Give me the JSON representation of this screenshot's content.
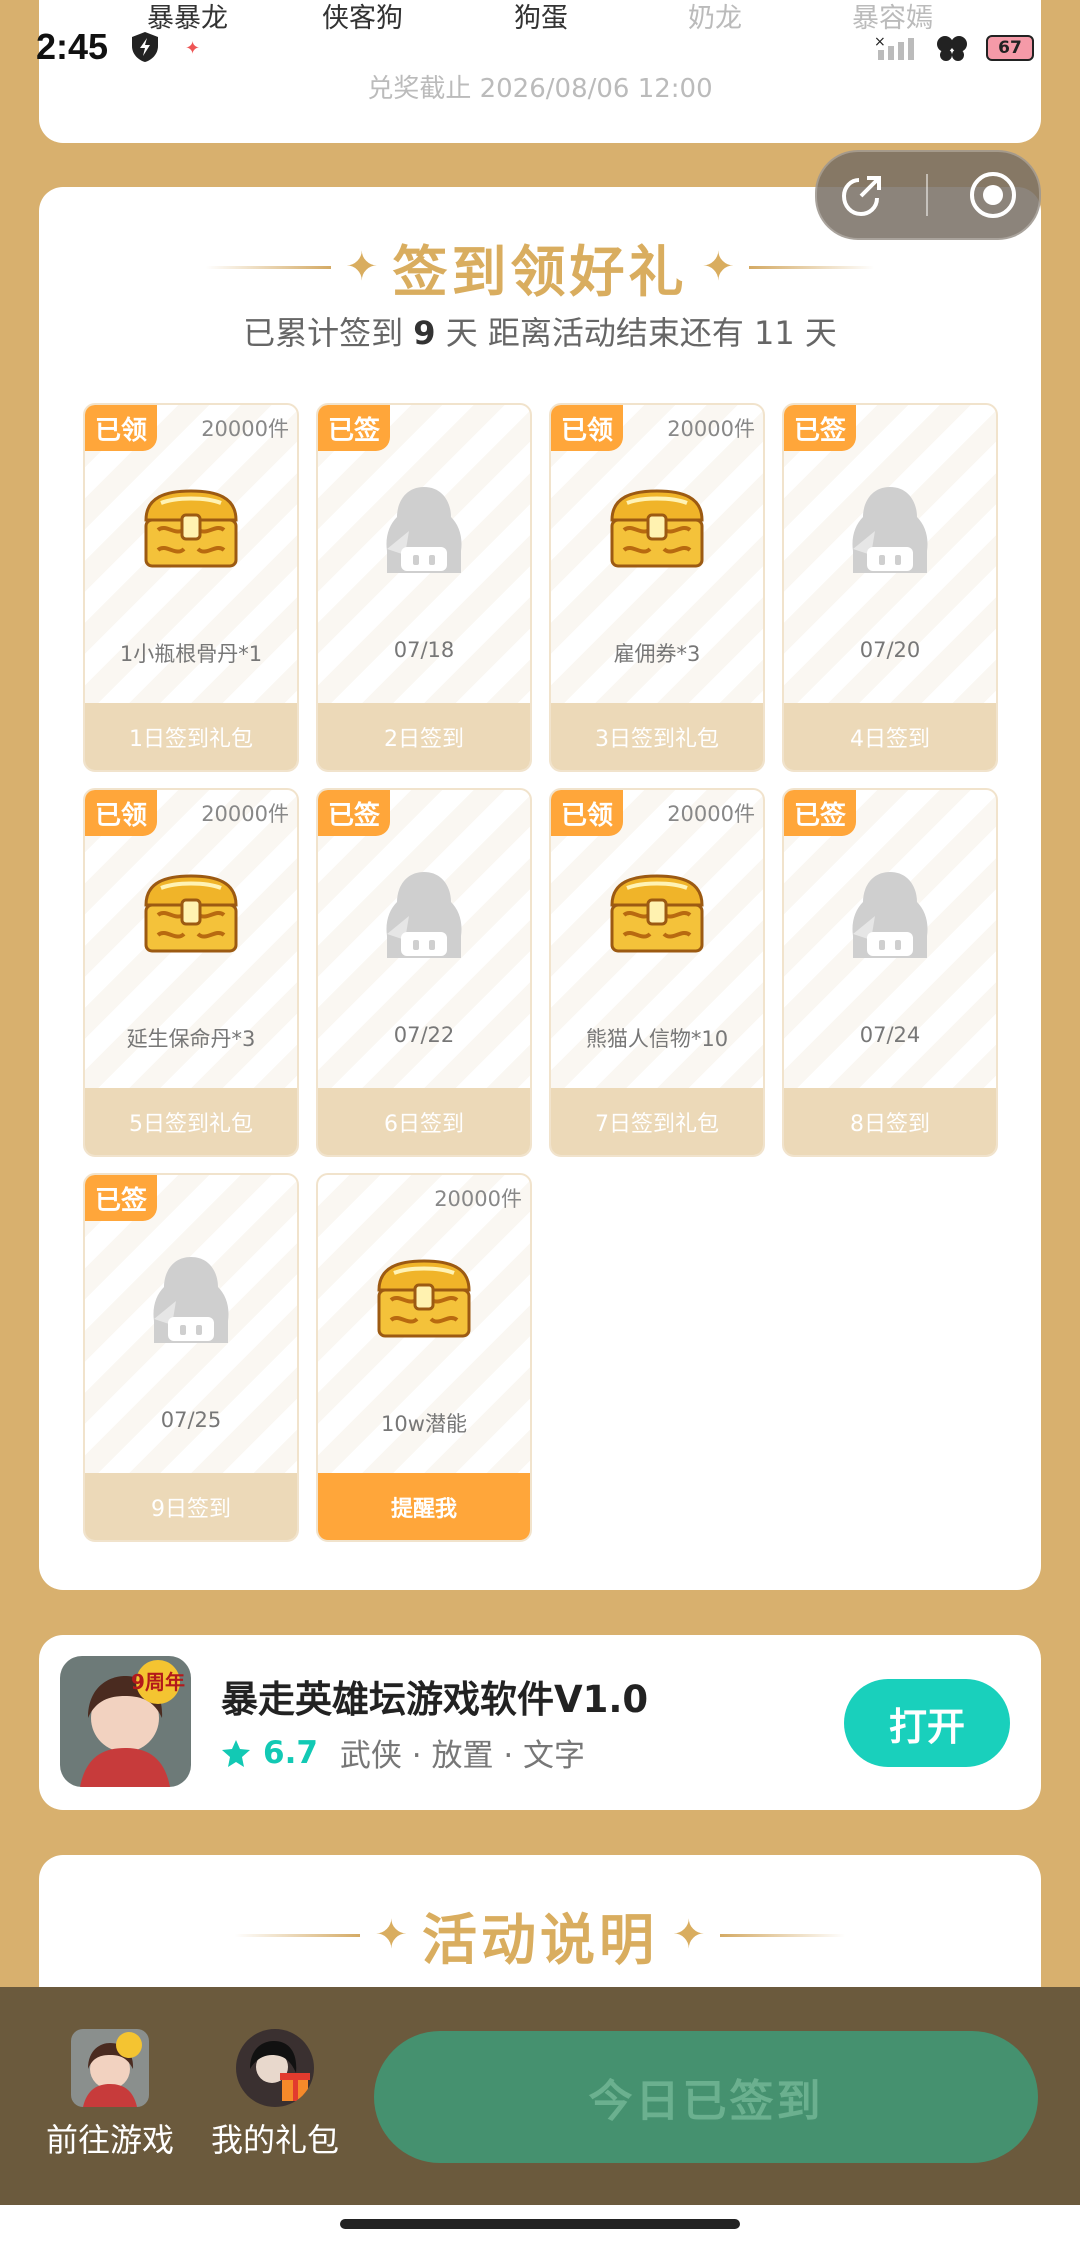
{
  "status_bar": {
    "time": "2:45",
    "battery": "67"
  },
  "top_tabs": [
    "暴暴龙",
    "侠客狗",
    "狗蛋",
    "奶龙",
    "暴容嫣"
  ],
  "deadline": "兑奖截止 2026/08/06 12:00",
  "signin": {
    "title": "签到领好礼",
    "sub_prefix": "已累计签到",
    "days": "9",
    "sub_mid": "天  距离活动结束还有 11 天",
    "cells": [
      {
        "badge": "已领",
        "count": "20000件",
        "type": "chest",
        "label": "1小瓶根骨丹*1",
        "footer": "1日签到礼包"
      },
      {
        "badge": "已签",
        "count": "",
        "type": "avatar",
        "label": "07/18",
        "footer": "2日签到"
      },
      {
        "badge": "已领",
        "count": "20000件",
        "type": "chest",
        "label": "雇佣券*3",
        "footer": "3日签到礼包"
      },
      {
        "badge": "已签",
        "count": "",
        "type": "avatar",
        "label": "07/20",
        "footer": "4日签到"
      },
      {
        "badge": "已领",
        "count": "20000件",
        "type": "chest",
        "label": "延生保命丹*3",
        "footer": "5日签到礼包"
      },
      {
        "badge": "已签",
        "count": "",
        "type": "avatar",
        "label": "07/22",
        "footer": "6日签到"
      },
      {
        "badge": "已领",
        "count": "20000件",
        "type": "chest",
        "label": "熊猫人信物*10",
        "footer": "7日签到礼包"
      },
      {
        "badge": "已签",
        "count": "",
        "type": "avatar",
        "label": "07/24",
        "footer": "8日签到"
      },
      {
        "badge": "已签",
        "count": "",
        "type": "avatar",
        "label": "07/25",
        "footer": "9日签到"
      },
      {
        "badge": "",
        "count": "20000件",
        "type": "chest",
        "label": "10w潜能",
        "footer": "提醒我",
        "active": true
      }
    ]
  },
  "app": {
    "icon_badge": "9周年",
    "name": "暴走英雄坛游戏软件V1.0",
    "rating": "6.7",
    "tags": "武侠 · 放置 · 文字",
    "open_label": "打开"
  },
  "rules": {
    "title": "活动说明"
  },
  "bottom": {
    "go_game": "前往游戏",
    "my_gift": "我的礼包",
    "signed_label": "今日已签到"
  }
}
